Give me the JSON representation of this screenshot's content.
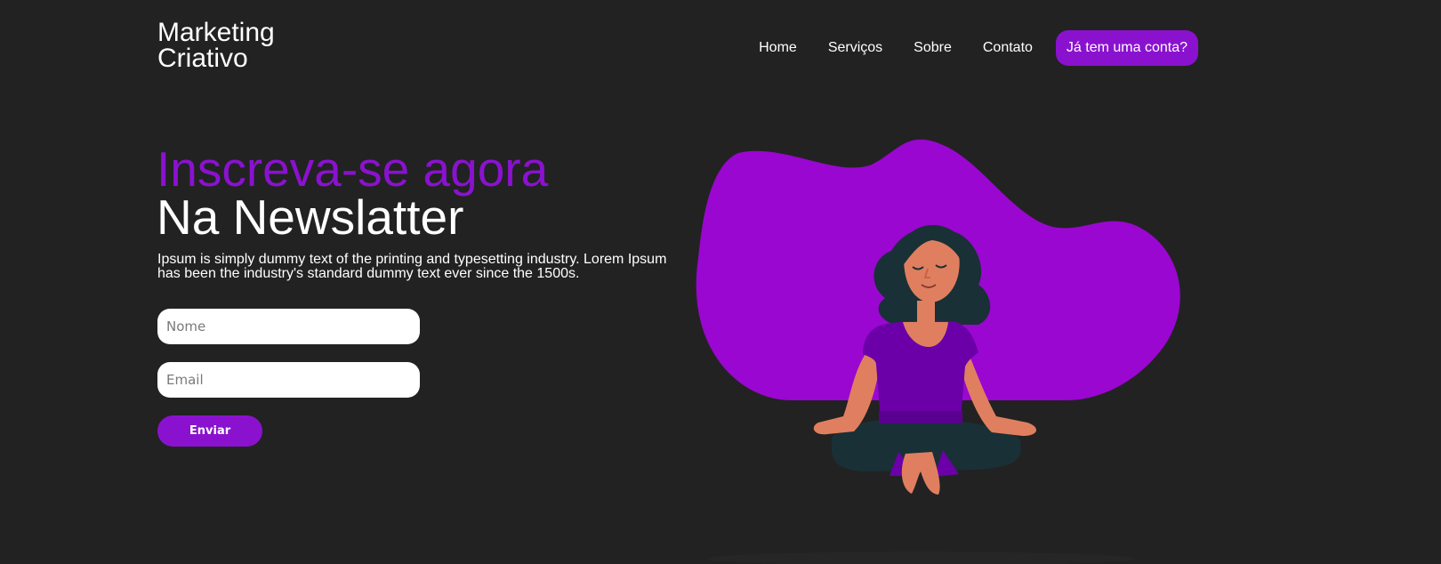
{
  "header": {
    "logo_line1": "Marketing",
    "logo_line2": "Criativo",
    "nav": {
      "home": "Home",
      "services": "Serviços",
      "about": "Sobre",
      "contact": "Contato"
    },
    "login_button": "Já tem uma conta?"
  },
  "hero": {
    "title_line1": "Inscreva-se agora",
    "title_line2": "Na Newslatter",
    "description": "Ipsum is simply dummy text of the printing and typesetting industry. Lorem Ipsum has been the industry's standard dummy text ever since the 1500s."
  },
  "form": {
    "name_placeholder": "Nome",
    "email_placeholder": "Email",
    "submit_label": "Enviar"
  },
  "colors": {
    "background": "#222222",
    "accent": "#8a12cf",
    "blob": "#9a07d0",
    "text": "#ffffff"
  },
  "illustration": {
    "subject": "meditating-woman",
    "icon": "meditation-illustration"
  }
}
